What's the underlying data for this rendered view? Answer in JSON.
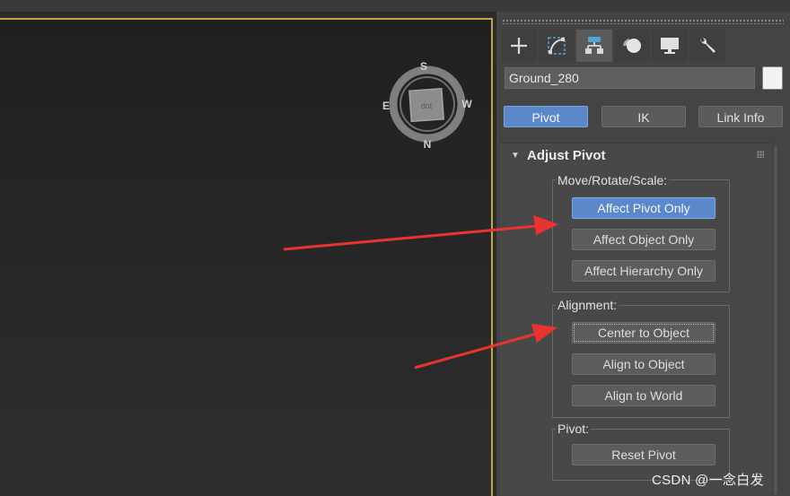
{
  "viewcube": {
    "north": "N",
    "south": "S",
    "east": "E",
    "west": "W",
    "face": "dot"
  },
  "command_panel": {
    "tabs": [
      {
        "name": "create",
        "icon": "plus-icon"
      },
      {
        "name": "modify",
        "icon": "modify-curve-icon"
      },
      {
        "name": "hierarchy",
        "icon": "hierarchy-icon"
      },
      {
        "name": "motion",
        "icon": "motion-icon"
      },
      {
        "name": "display",
        "icon": "display-monitor-icon"
      },
      {
        "name": "utilities",
        "icon": "wrench-icon"
      }
    ],
    "active_tab": "hierarchy",
    "object_name": "Ground_280",
    "object_color": "#f2f2f2",
    "sub_tabs": [
      "Pivot",
      "IK",
      "Link Info"
    ],
    "active_sub_tab": "Pivot"
  },
  "rollout": {
    "title": "Adjust Pivot",
    "move_group": {
      "label": "Move/Rotate/Scale:",
      "buttons": [
        "Affect Pivot Only",
        "Affect Object Only",
        "Affect Hierarchy Only"
      ]
    },
    "alignment_group": {
      "label": "Alignment:",
      "buttons": [
        "Center to Object",
        "Align to Object",
        "Align to World"
      ]
    },
    "pivot_group": {
      "label": "Pivot:",
      "buttons": [
        "Reset Pivot"
      ]
    }
  },
  "colors": {
    "accent_blue": "#5b88c9",
    "annotation_red": "#e8332f",
    "viewport_border": "#c6a24a"
  },
  "watermark": "CSDN @一念白发"
}
